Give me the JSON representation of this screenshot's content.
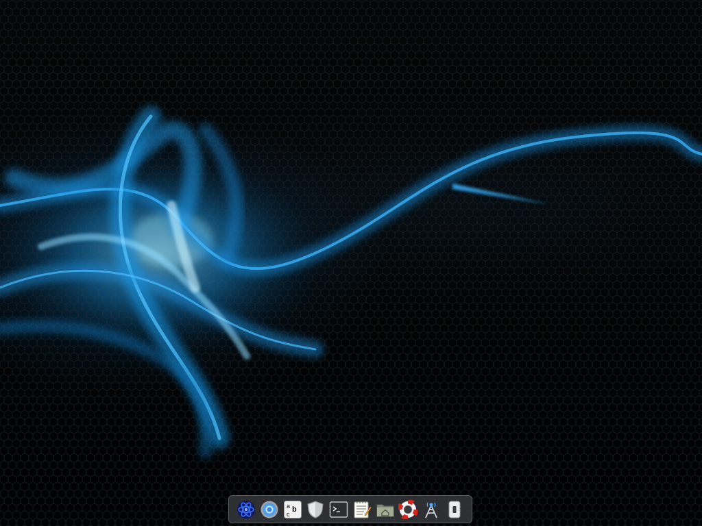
{
  "desktop": {
    "wallpaper": {
      "base_color": "#020304",
      "accent_color": "#1aa0ff"
    },
    "dock": {
      "items": [
        {
          "icon": "atom-icon"
        },
        {
          "icon": "browser-globe-icon"
        },
        {
          "icon": "text-editor-abc-icon"
        },
        {
          "icon": "shield-icon"
        },
        {
          "icon": "terminal-icon"
        },
        {
          "icon": "notepad-icon"
        },
        {
          "icon": "home-folder-icon"
        },
        {
          "icon": "lifebuoy-help-icon"
        },
        {
          "icon": "antenna-network-icon"
        },
        {
          "icon": "mobile-device-icon"
        }
      ]
    }
  }
}
